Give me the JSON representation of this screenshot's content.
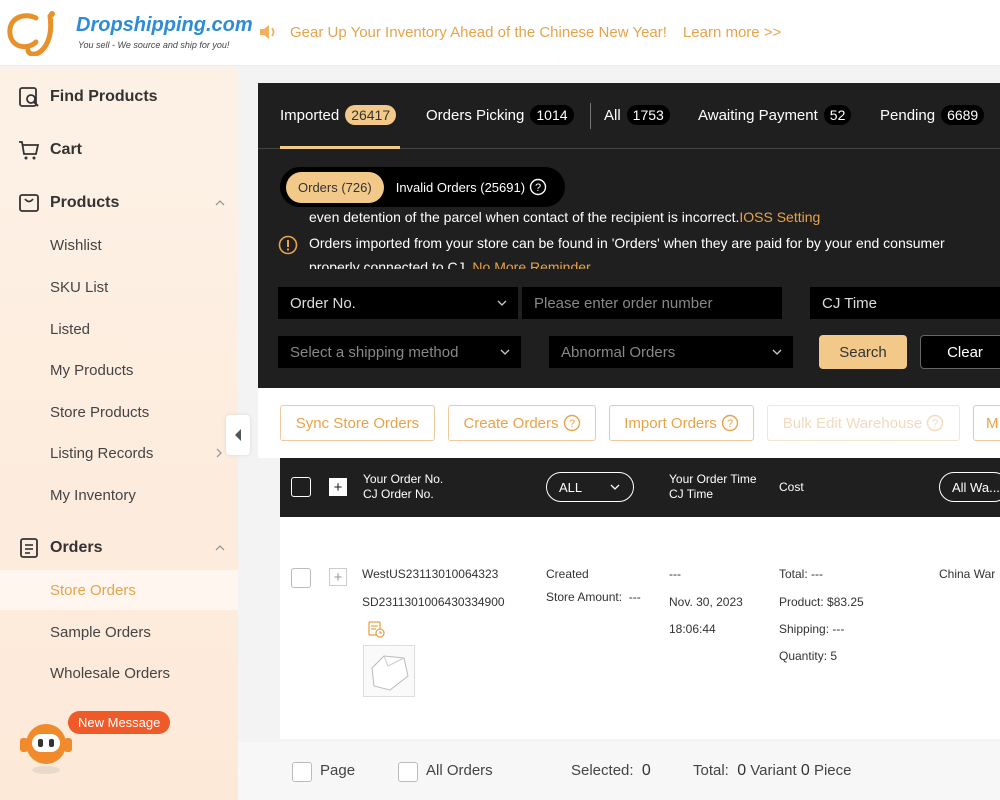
{
  "brand": {
    "title": "Dropshipping.com",
    "tagline": "You sell - We source and ship for you!",
    "colors": {
      "accent": "#e8a34a",
      "brand_blue": "#2d8bd8"
    }
  },
  "announcement": {
    "text": "Gear Up Your Inventory Ahead of the Chinese New Year!",
    "link": "Learn more >>"
  },
  "sidebar": {
    "sections": {
      "find_products": "Find Products",
      "cart": "Cart",
      "products": "Products",
      "orders": "Orders"
    },
    "product_items": [
      "Wishlist",
      "SKU List",
      "Listed",
      "My Products",
      "Store Products",
      "Listing Records",
      "My Inventory"
    ],
    "order_items": [
      "Store Orders",
      "Sample Orders",
      "Wholesale Orders"
    ],
    "active_item": "Store Orders",
    "new_message": "New Message"
  },
  "tabs": [
    {
      "label": "Imported",
      "count": "26417"
    },
    {
      "label": "Orders Picking",
      "count": "1014"
    },
    {
      "label": "All",
      "count": "1753"
    },
    {
      "label": "Awaiting Payment",
      "count": "52"
    },
    {
      "label": "Pending",
      "count": "6689"
    }
  ],
  "subtabs": {
    "orders": "Orders (726)",
    "invalid": "Invalid Orders (25691)"
  },
  "notice": {
    "line1": "even detention of the parcel when contact of the recipient is incorrect.",
    "line1_link": "IOSS Setting",
    "line2": "Orders imported from your store can be found in 'Orders' when they are paid for by your end consumer",
    "line3": "properly connected to CJ.",
    "line3_link": "No More Reminder"
  },
  "filters": {
    "order_field": "Order No.",
    "order_placeholder": "Please enter order number",
    "time_field": "CJ Time",
    "shipping_placeholder": "Select a shipping method",
    "abnormal": "Abnormal Orders",
    "search": "Search",
    "clear": "Clear"
  },
  "actions": {
    "sync": "Sync Store Orders",
    "create": "Create Orders",
    "import": "Import Orders",
    "bulk": "Bulk Edit Warehouse",
    "more": "M"
  },
  "table_header": {
    "order_no_1": "Your Order No.",
    "order_no_2": "CJ Order No.",
    "status_select": "ALL",
    "time_1": "Your Order Time",
    "time_2": "CJ Time",
    "cost": "Cost",
    "warehouse_select": "All Wa..."
  },
  "order": {
    "your_order_no": "WestUS23113010064323",
    "cj_order_no": "SD2311301006430334900",
    "status": "Created",
    "store_amount_label": "Store Amount:",
    "store_amount": "---",
    "your_time": "---",
    "cj_date": "Nov. 30, 2023",
    "cj_time": "18:06:44",
    "total": "Total: ---",
    "product": "Product: $83.25",
    "shipping": "Shipping: ---",
    "quantity": "Quantity: 5",
    "warehouse": "China War"
  },
  "footer": {
    "page": "Page",
    "all_orders": "All Orders",
    "selected_label": "Selected:",
    "selected": "0",
    "total_label": "Total:",
    "variant_count": "0",
    "variant_label": "Variant",
    "piece_count": "0",
    "piece_label": "Piece"
  }
}
